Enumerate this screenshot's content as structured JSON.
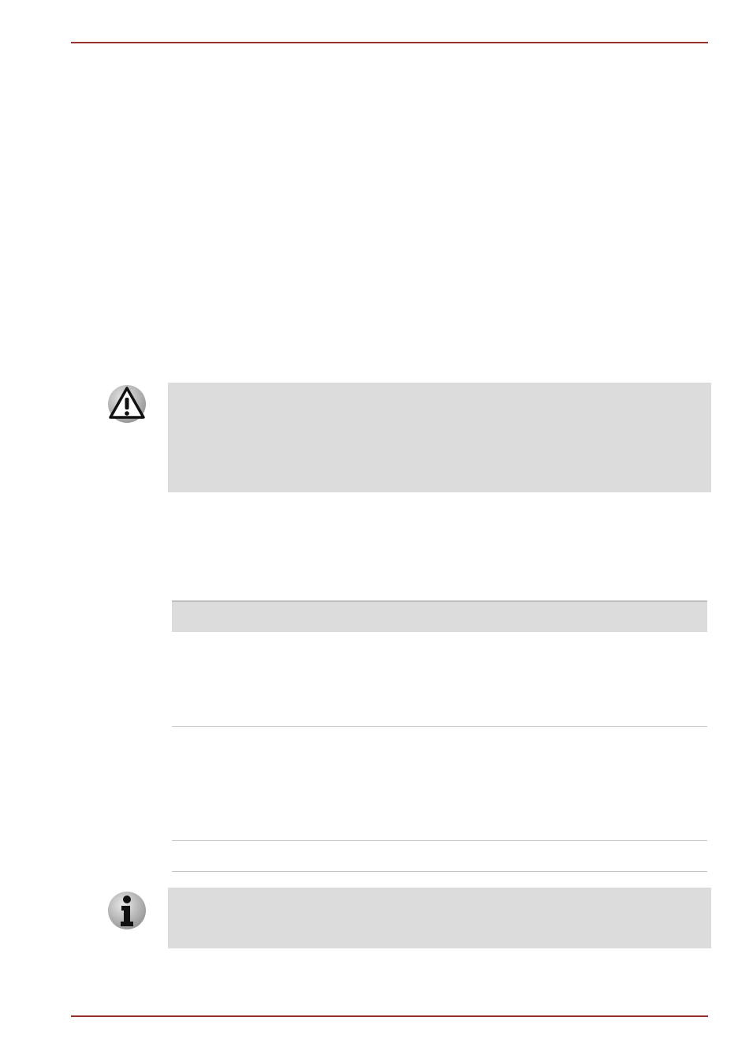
{
  "colors": {
    "rule": "#9a2f2f",
    "callout_background": "#dcdcdc",
    "table_header_background": "#dcdcdc",
    "table_divider": "#c4c4c4"
  },
  "icons": {
    "caution": "warning-triangle-icon",
    "note": "info-icon"
  },
  "table": {
    "row_count": 3
  }
}
